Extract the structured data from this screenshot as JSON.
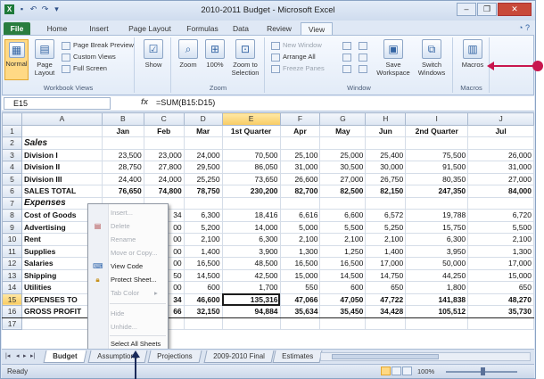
{
  "window": {
    "title": "2010-2011 Budget - Microsoft Excel",
    "quick_access_icons": [
      "excel-icon",
      "save-icon",
      "undo-icon",
      "redo-icon",
      "customize-icon"
    ]
  },
  "ribbon_tabs": [
    {
      "label": "File"
    },
    {
      "label": "Home"
    },
    {
      "label": "Insert"
    },
    {
      "label": "Page Layout"
    },
    {
      "label": "Formulas"
    },
    {
      "label": "Data"
    },
    {
      "label": "Review"
    },
    {
      "label": "View"
    }
  ],
  "active_tab": "View",
  "ribbon": {
    "workbook_views": {
      "label": "Workbook Views",
      "normal": "Normal",
      "page_layout": "Page Layout",
      "page_break_preview": "Page Break Preview",
      "custom_views": "Custom Views",
      "full_screen": "Full Screen"
    },
    "show": {
      "label": "Show"
    },
    "zoom": {
      "label": "Zoom",
      "zoom": "Zoom",
      "hundred": "100%",
      "zoom_selection": "Zoom to Selection"
    },
    "window": {
      "label": "Window",
      "new_window": "New Window",
      "arrange_all": "Arrange All",
      "freeze_panes": "Freeze Panes",
      "save_workspace": "Save Workspace",
      "switch_windows": "Switch Windows"
    },
    "macros": {
      "label": "Macros",
      "button": "Macros"
    }
  },
  "formula_bar": {
    "name_box": "E15",
    "fx": "fx",
    "formula": "=SUM(B15:D15)"
  },
  "columns": [
    "A",
    "B",
    "C",
    "D",
    "E",
    "F",
    "G",
    "H",
    "I",
    "J"
  ],
  "rows": [
    {
      "n": "1",
      "cells": [
        "",
        "Jan",
        "Feb",
        "Mar",
        "1st Quarter",
        "Apr",
        "May",
        "Jun",
        "2nd Quarter",
        "Jul"
      ]
    },
    {
      "n": "2",
      "cells": [
        "Sales",
        "",
        "",
        "",
        "",
        "",
        "",
        "",
        "",
        ""
      ]
    },
    {
      "n": "3",
      "cells": [
        "Division I",
        "23,500",
        "23,000",
        "24,000",
        "70,500",
        "25,100",
        "25,000",
        "25,400",
        "75,500",
        "26,000"
      ]
    },
    {
      "n": "4",
      "cells": [
        "Division II",
        "28,750",
        "27,800",
        "29,500",
        "86,050",
        "31,000",
        "30,500",
        "30,000",
        "91,500",
        "31,000"
      ]
    },
    {
      "n": "5",
      "cells": [
        "Division III",
        "24,400",
        "24,000",
        "25,250",
        "73,650",
        "26,600",
        "27,000",
        "26,750",
        "80,350",
        "27,000"
      ]
    },
    {
      "n": "6",
      "cells": [
        "SALES TOTAL",
        "76,650",
        "74,800",
        "78,750",
        "230,200",
        "82,700",
        "82,500",
        "82,150",
        "247,350",
        "84,000"
      ]
    },
    {
      "n": "7",
      "cells": [
        "Expenses",
        "",
        "",
        "",
        "",
        "",
        "",
        "",
        "",
        ""
      ]
    },
    {
      "n": "8",
      "cells": [
        "Cost of Goods",
        "",
        "34",
        "6,300",
        "18,416",
        "6,616",
        "6,600",
        "6,572",
        "19,788",
        "6,720"
      ]
    },
    {
      "n": "9",
      "cells": [
        "Advertising",
        "",
        "00",
        "5,200",
        "14,000",
        "5,000",
        "5,500",
        "5,250",
        "15,750",
        "5,500"
      ]
    },
    {
      "n": "10",
      "cells": [
        "Rent",
        "",
        "00",
        "2,100",
        "6,300",
        "2,100",
        "2,100",
        "2,100",
        "6,300",
        "2,100"
      ]
    },
    {
      "n": "11",
      "cells": [
        "Supplies",
        "",
        "00",
        "1,400",
        "3,900",
        "1,300",
        "1,250",
        "1,400",
        "3,950",
        "1,300"
      ]
    },
    {
      "n": "12",
      "cells": [
        "Salaries",
        "",
        "00",
        "16,500",
        "48,500",
        "16,500",
        "16,500",
        "17,000",
        "50,000",
        "17,000"
      ]
    },
    {
      "n": "13",
      "cells": [
        "Shipping",
        "",
        "50",
        "14,500",
        "42,500",
        "15,000",
        "14,500",
        "14,750",
        "44,250",
        "15,000"
      ]
    },
    {
      "n": "14",
      "cells": [
        "Utilities",
        "",
        "00",
        "600",
        "1,700",
        "550",
        "600",
        "650",
        "1,800",
        "650"
      ]
    },
    {
      "n": "15",
      "cells": [
        "EXPENSES TO",
        "",
        "34",
        "46,600",
        "135,316",
        "47,066",
        "47,050",
        "47,722",
        "141,838",
        "48,270"
      ]
    },
    {
      "n": "16",
      "cells": [
        "GROSS PROFIT",
        "",
        "66",
        "32,150",
        "94,884",
        "35,634",
        "35,450",
        "34,428",
        "105,512",
        "35,730"
      ]
    },
    {
      "n": "17",
      "cells": [
        "",
        "",
        "",
        "",
        "",
        "",
        "",
        "",
        "",
        ""
      ]
    }
  ],
  "context_menu": [
    {
      "label": "Insert...",
      "enabled": false,
      "icon": ""
    },
    {
      "label": "Delete",
      "enabled": false,
      "icon": "delete-sheet-icon"
    },
    {
      "label": "Rename",
      "enabled": false,
      "icon": ""
    },
    {
      "label": "Move or Copy...",
      "enabled": false,
      "icon": ""
    },
    {
      "label": "View Code",
      "enabled": true,
      "icon": "view-code-icon"
    },
    {
      "label": "Protect Sheet...",
      "enabled": true,
      "icon": "protect-sheet-icon"
    },
    {
      "label": "Tab Color",
      "enabled": false,
      "icon": ""
    },
    {
      "label": "Hide",
      "enabled": false,
      "icon": ""
    },
    {
      "label": "Unhide...",
      "enabled": false,
      "icon": ""
    },
    {
      "label": "Select All Sheets",
      "enabled": true,
      "icon": ""
    }
  ],
  "sheet_tabs": [
    {
      "label": "Budget",
      "active": true
    },
    {
      "label": "Assumptions",
      "active": false
    },
    {
      "label": "Projections",
      "active": false
    },
    {
      "label": "2009-2010 Final",
      "active": false
    },
    {
      "label": "Estimates",
      "active": false
    }
  ],
  "status": {
    "ready": "Ready",
    "zoom": "100%"
  },
  "colors": {
    "file_tab": "#2a7d3f",
    "callout_arrow": "#c8174e",
    "selection": "#f8cc63"
  }
}
